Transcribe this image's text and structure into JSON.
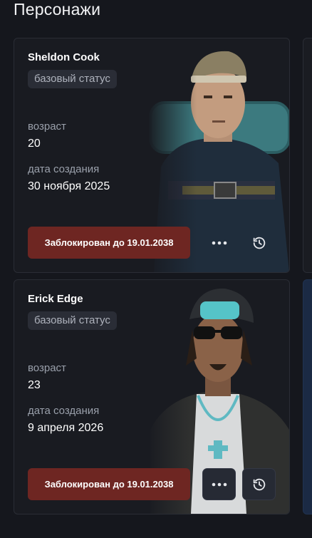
{
  "page": {
    "title": "Персонажи"
  },
  "labels": {
    "age": "возраст",
    "created": "дата создания"
  },
  "characters": [
    {
      "name": "Sheldon Cook",
      "status": "базовый статус",
      "age": "20",
      "created": "30 ноября 2025",
      "blocked": "Заблокирован до 19.01.2038"
    },
    {
      "name": "Erick Edge",
      "status": "базовый статус",
      "age": "23",
      "created": "9 апреля 2026",
      "blocked": "Заблокирован до 19.01.2038"
    }
  ],
  "icons": {
    "more": "more-dots-icon",
    "history": "history-clock-icon"
  },
  "colors": {
    "blocked": "#6e2622",
    "badge": "#2a2d36",
    "background": "#15171d"
  }
}
